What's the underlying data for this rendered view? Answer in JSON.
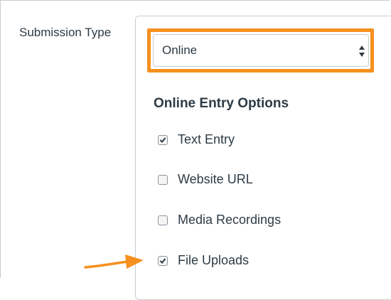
{
  "submission_type": {
    "label": "Submission Type",
    "selected": "Online"
  },
  "online_entry_options": {
    "title": "Online Entry Options",
    "options": [
      {
        "label": "Text Entry",
        "checked": true
      },
      {
        "label": "Website URL",
        "checked": false
      },
      {
        "label": "Media Recordings",
        "checked": false
      },
      {
        "label": "File Uploads",
        "checked": true
      }
    ]
  },
  "colors": {
    "highlight": "#f6901e",
    "text": "#2d3b45",
    "border": "#c7cdd1"
  },
  "icons": {
    "select_arrows": "up-down-arrows-icon",
    "annotation": "orange-arrow-icon"
  }
}
